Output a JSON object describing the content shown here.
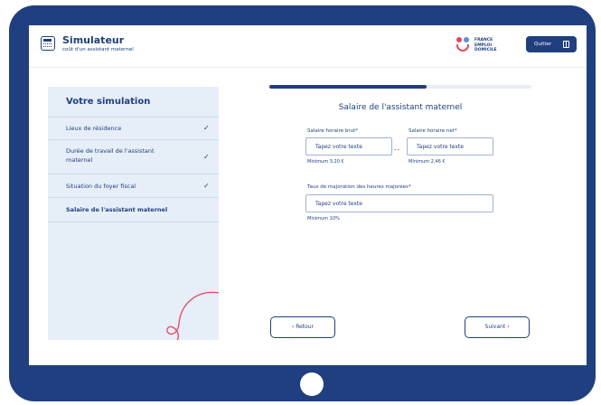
{
  "header": {
    "title": "Simulateur",
    "subtitle": "coût d'un assistant maternel",
    "logo_text": [
      "FRANCE",
      "EMPLOI",
      "DOMICILE"
    ],
    "quit_label": "Quitter"
  },
  "sidebar": {
    "title": "Votre simulation",
    "items": [
      {
        "label": "Lieux de résidence",
        "done": true
      },
      {
        "label": "Durée de travail de l'assistant maternel",
        "done": true
      },
      {
        "label": "Situation du foyer fiscal",
        "done": true
      },
      {
        "label": "Salaire de l'assistant maternel",
        "done": false,
        "current": true
      }
    ]
  },
  "progress": {
    "fraction": 0.6
  },
  "form": {
    "title": "Salaire de l'assistant maternel",
    "fields": {
      "gross": {
        "label": "Salaire horaire brut*",
        "placeholder": "Tapez votre texte",
        "help": "Minimum 3,20 €"
      },
      "net": {
        "label": "Salaire horaire net*",
        "placeholder": "Tapez votre texte",
        "help": "Minimum 2,46 €"
      },
      "overtime": {
        "label": "Taux de majoration des heures majorées*",
        "placeholder": "Tapez votre texte",
        "help": "Minimum 10%"
      }
    },
    "separator": "--"
  },
  "nav": {
    "back_label": "‹  Retour",
    "next_label": "Suivant  ›"
  },
  "colors": {
    "primary": "#1f3f80",
    "sidebar_bg": "#e6eef8",
    "accent": "#e8475a"
  }
}
